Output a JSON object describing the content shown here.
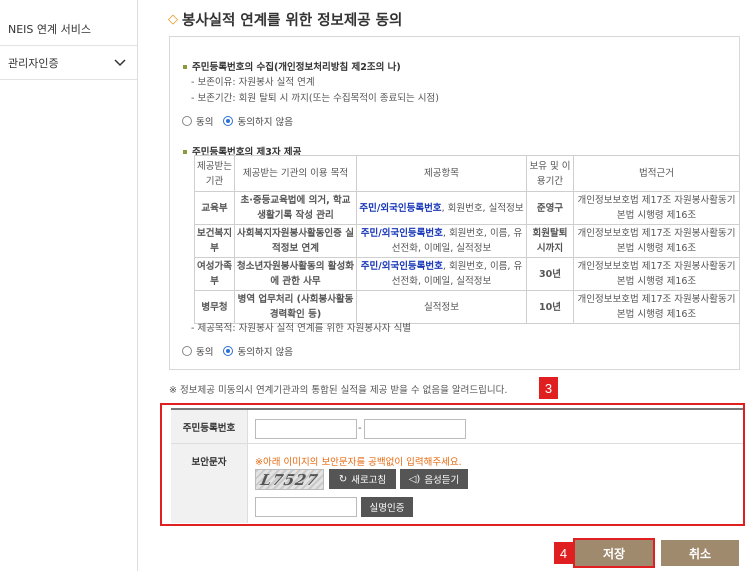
{
  "sidebar": {
    "items": [
      {
        "label": "NEIS 연계 서비스"
      },
      {
        "label": "관리자인증"
      }
    ]
  },
  "main": {
    "title": "봉사실적 연계를 위한 정보제공 동의",
    "collection": {
      "heading": "주민등록번호의 수집(개인정보처리방침 제2조의 나)",
      "lines": [
        "- 보존이유: 자원봉사 실적 연계",
        "- 보존기간: 회원 탈퇴 시 까지(또는 수집목적이 종료되는 시점)"
      ],
      "radio_agree": "동의",
      "radio_disagree": "동의하지 않음"
    },
    "third_party": {
      "heading": "주민등록번호의 제3자 제공",
      "headers": [
        "제공받는 기관",
        "제공받는 기관의 이용 목적",
        "제공항목",
        "보유 및 이용기간",
        "법적근거"
      ],
      "rows": [
        {
          "org": "교육부",
          "purpose": "초·중등교육법에 의거, 학교생활기록 작성 관리",
          "items_blue": "주민/외국인등록번호",
          "items_rest": ", 회원번호, 실적정보",
          "period": "준영구",
          "basis": "개인정보보호법 제17조 자원봉사활동기본법 시행령 제16조"
        },
        {
          "org": "보건복지부",
          "purpose": "사회복지자원봉사활동인증 실적정보 연계",
          "items_blue": "주민/외국인등록번호",
          "items_rest": ", 회원번호, 이름, 유선전화, 이메일, 실적정보",
          "period": "회원탈퇴시까지",
          "basis": "개인정보보호법 제17조 자원봉사활동기본법 시행령 제16조"
        },
        {
          "org": "여성가족부",
          "purpose": "청소년자원봉사활동의 활성화에 관한 사무",
          "items_blue": "주민/외국인등록번호",
          "items_rest": ", 회원번호, 이름, 유선전화, 이메일, 실적정보",
          "period": "30년",
          "basis": "개인정보보호법 제17조 자원봉사활동기본법 시행령 제16조"
        },
        {
          "org": "병무청",
          "purpose": "병역 업무처리 (사회봉사활동 경력확인 등)",
          "items_blue": "",
          "items_rest": "실적정보",
          "period": "10년",
          "basis": "개인정보보호법 제17조 자원봉사활동기본법 시행령 제16조"
        }
      ],
      "footer": "- 제공목적: 자원봉사 실적 연계를 위한 자원봉사자 식별",
      "radio_agree": "동의",
      "radio_disagree": "동의하지 않음"
    },
    "notice": "※ 정보제공 미동의시 연계기관과의 통합된 실적을 제공 받을 수 없음을 알려드립니다.",
    "form": {
      "rrn_label": "주민등록번호",
      "rrn_dash": "-",
      "captcha_label": "보안문자",
      "captcha_warning": "※아래 이미지의 보안문자를 공백없이 입력해주세요.",
      "captcha_text": "L7527",
      "refresh_label": "새로고침",
      "audio_label": "음성듣기",
      "verify_label": "실명인증"
    },
    "badges": {
      "form": "3",
      "save": "4"
    },
    "actions": {
      "save": "저장",
      "cancel": "취소"
    }
  },
  "colors": {
    "highlight": "#e02020",
    "link_blue": "#1736b8",
    "warning": "#e86a10",
    "button_brown": "#a08a6e"
  }
}
